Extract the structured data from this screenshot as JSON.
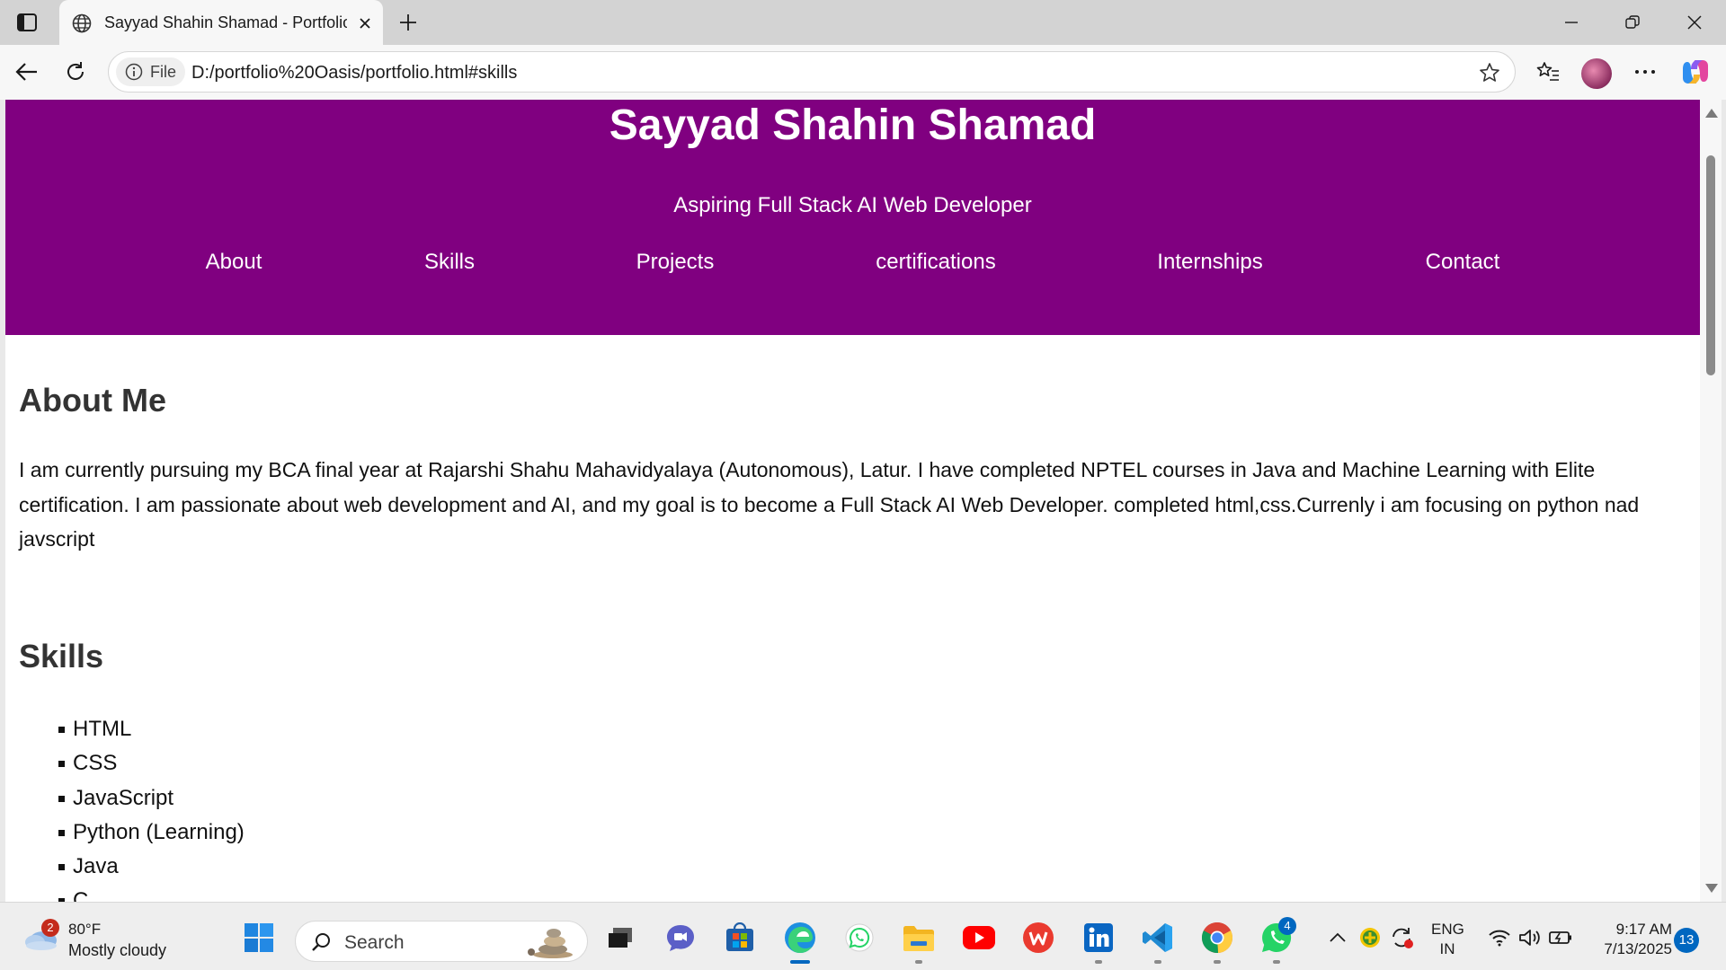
{
  "browser": {
    "tab_title": "Sayyad Shahin Shamad - Portfolio",
    "site_chip_label": "File",
    "url": "D:/portfolio%20Oasis/portfolio.html#skills"
  },
  "page": {
    "header_title": "Sayyad Shahin Shamad",
    "subtitle": "Aspiring Full Stack AI Web Developer",
    "nav": [
      "About",
      "Skills",
      "Projects",
      "certifications",
      "Internships",
      "Contact"
    ],
    "about_heading": "About Me",
    "about_text": "I am currently pursuing my BCA final year at Rajarshi Shahu Mahavidyalaya (Autonomous), Latur. I have completed NPTEL courses in Java and Machine Learning with Elite certification. I am passionate about web development and AI, and my goal is to become a Full Stack AI Web Developer. completed html,css.Currenly i am focusing on python nad javscript",
    "skills_heading": "Skills",
    "skills": [
      "HTML",
      "CSS",
      "JavaScript",
      "Python (Learning)",
      "Java",
      "C"
    ],
    "header_color": "#800080"
  },
  "taskbar": {
    "weather_badge": "2",
    "weather_temp": "80°F",
    "weather_condition": "Mostly cloudy",
    "search_label": "Search",
    "whatsapp_badge": "4",
    "lang_line1": "ENG",
    "lang_line2": "IN",
    "time": "9:17 AM",
    "date": "7/13/2025",
    "notification_count": "13"
  }
}
